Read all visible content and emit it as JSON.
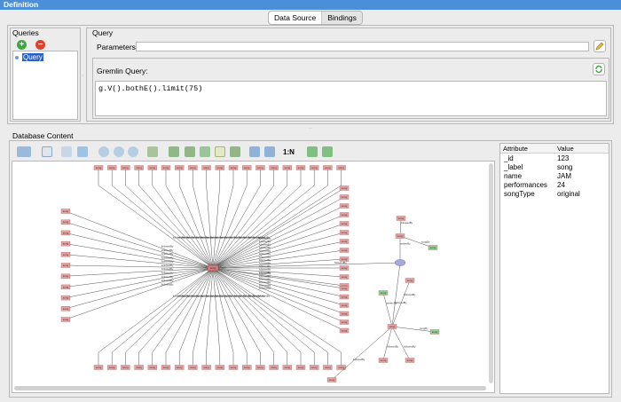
{
  "window": {
    "title": "Definition"
  },
  "tabs": [
    {
      "label": "Data Source"
    },
    {
      "label": "Bindings"
    }
  ],
  "queries": {
    "title": "Queries",
    "items": [
      {
        "label": "Query"
      }
    ]
  },
  "query": {
    "title": "Query",
    "parameters_label": "Parameters:",
    "parameters_value": "",
    "gremlin_label": "Gremlin Query:",
    "gremlin_text": "g.V().bothE().limit(75)"
  },
  "database": {
    "title": "Database Content",
    "zoom_label": "1:N",
    "attributes": {
      "headers": [
        "Attribute",
        "Value"
      ],
      "rows": [
        {
          "key": "_id",
          "value": "123"
        },
        {
          "key": "_label",
          "value": "song"
        },
        {
          "key": "name",
          "value": "JAM"
        },
        {
          "key": "performances",
          "value": "24"
        },
        {
          "key": "songType",
          "value": "original"
        }
      ]
    }
  },
  "graph": {
    "node_label": "song",
    "edge_label": "followedBy",
    "accent_edge_label": "sungBy",
    "other_edge_label": "writtenBy"
  },
  "colors": {
    "titlebar": "#4a8fd8",
    "node": "#e6a2a2",
    "node_green": "#8fd18f",
    "node_selected": "#a9a9d8",
    "add": "#3da83d",
    "remove": "#d9442e"
  },
  "icons": [
    "add-icon",
    "remove-icon",
    "edit-icon",
    "refresh-icon"
  ]
}
